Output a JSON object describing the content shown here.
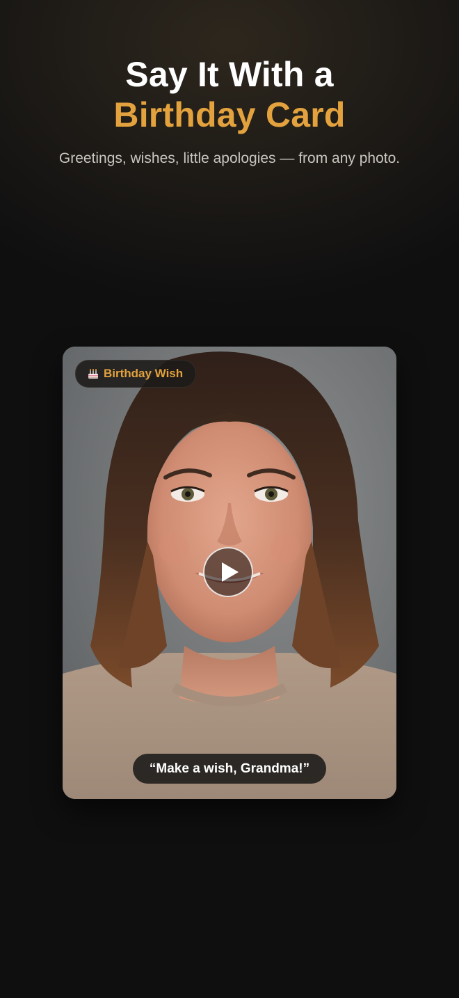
{
  "hero": {
    "title_part1": "Say It With a ",
    "title_accent": "Birthday Card",
    "subtitle": "Greetings, wishes, little apologies — from any photo."
  },
  "card": {
    "badge_icon": "birthday-cake-icon",
    "badge_label": "Birthday Wish",
    "play_icon": "play-icon",
    "caption": "“Make a wish, Grandma!”"
  },
  "colors": {
    "background": "#0f0f10",
    "accent": "#e3a23e",
    "title": "#ffffff",
    "subtitle": "#c9c6c0"
  }
}
